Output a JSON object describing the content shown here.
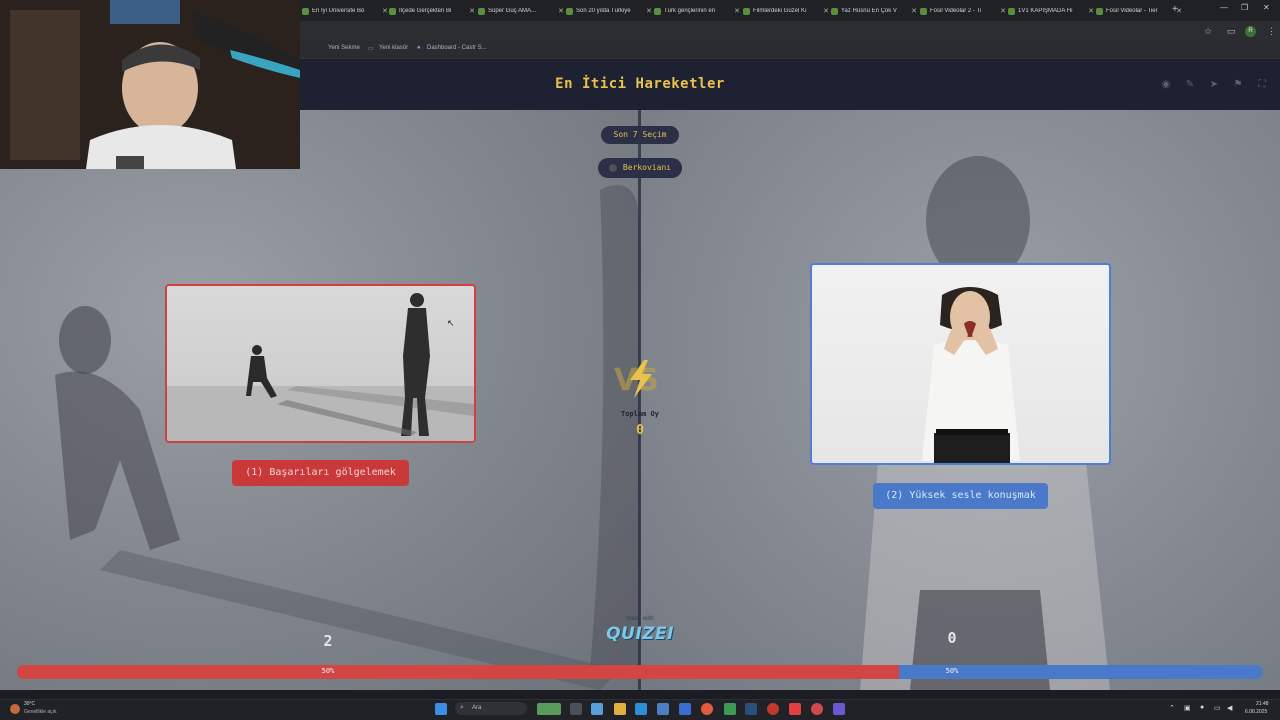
{
  "browser": {
    "tabs": [
      {
        "label": "En İyi Üniversite Bö"
      },
      {
        "label": "İlçede Gerçekten Bi"
      },
      {
        "label": "Süper Güç AMA..."
      },
      {
        "label": "Son 20 yılda Türkiye"
      },
      {
        "label": "Türk gençlerinin en"
      },
      {
        "label": "Filmlerdeki Güzel Kı"
      },
      {
        "label": "Yaz Hüsnü En Çok V"
      },
      {
        "label": "Fosil Videolar 2 - Ti"
      },
      {
        "label": "1V1 KAPIŞMADA Hı"
      },
      {
        "label": "Fosil Videolar - Tier"
      }
    ],
    "new_tab_glyph": "+",
    "bookmarks": [
      {
        "label": "Yeni Sekme"
      },
      {
        "label": "Yeni klasör"
      },
      {
        "label": "Dashboard - Castr S..."
      }
    ],
    "profile_initial": "R"
  },
  "page": {
    "title": "En İtici Hareketler",
    "recent_label": "Son 7 Seçim",
    "username": "Berkovianı",
    "left_option_label": "(1) Başarıları gölgelemek",
    "right_option_label": "(2) Yüksek sesle konuşmak",
    "vs_text": "VS",
    "total_votes_label": "Toplam Oy",
    "total_votes": "0",
    "left_votes": "2",
    "right_votes": "0",
    "left_percent_label": "50%",
    "right_percent_label": "50%",
    "left_percent": 50,
    "made_with": "made with",
    "brand": "QUIZEI",
    "colors": {
      "accent": "#e6c04e",
      "left": "#d24545",
      "right": "#4a79c9",
      "header": "#1e2131"
    }
  },
  "taskbar": {
    "weather_temp": "30°C",
    "weather_desc": "Genellikle açık",
    "search_label": "Ara",
    "time": "21:48",
    "date": "6.08.2025"
  }
}
